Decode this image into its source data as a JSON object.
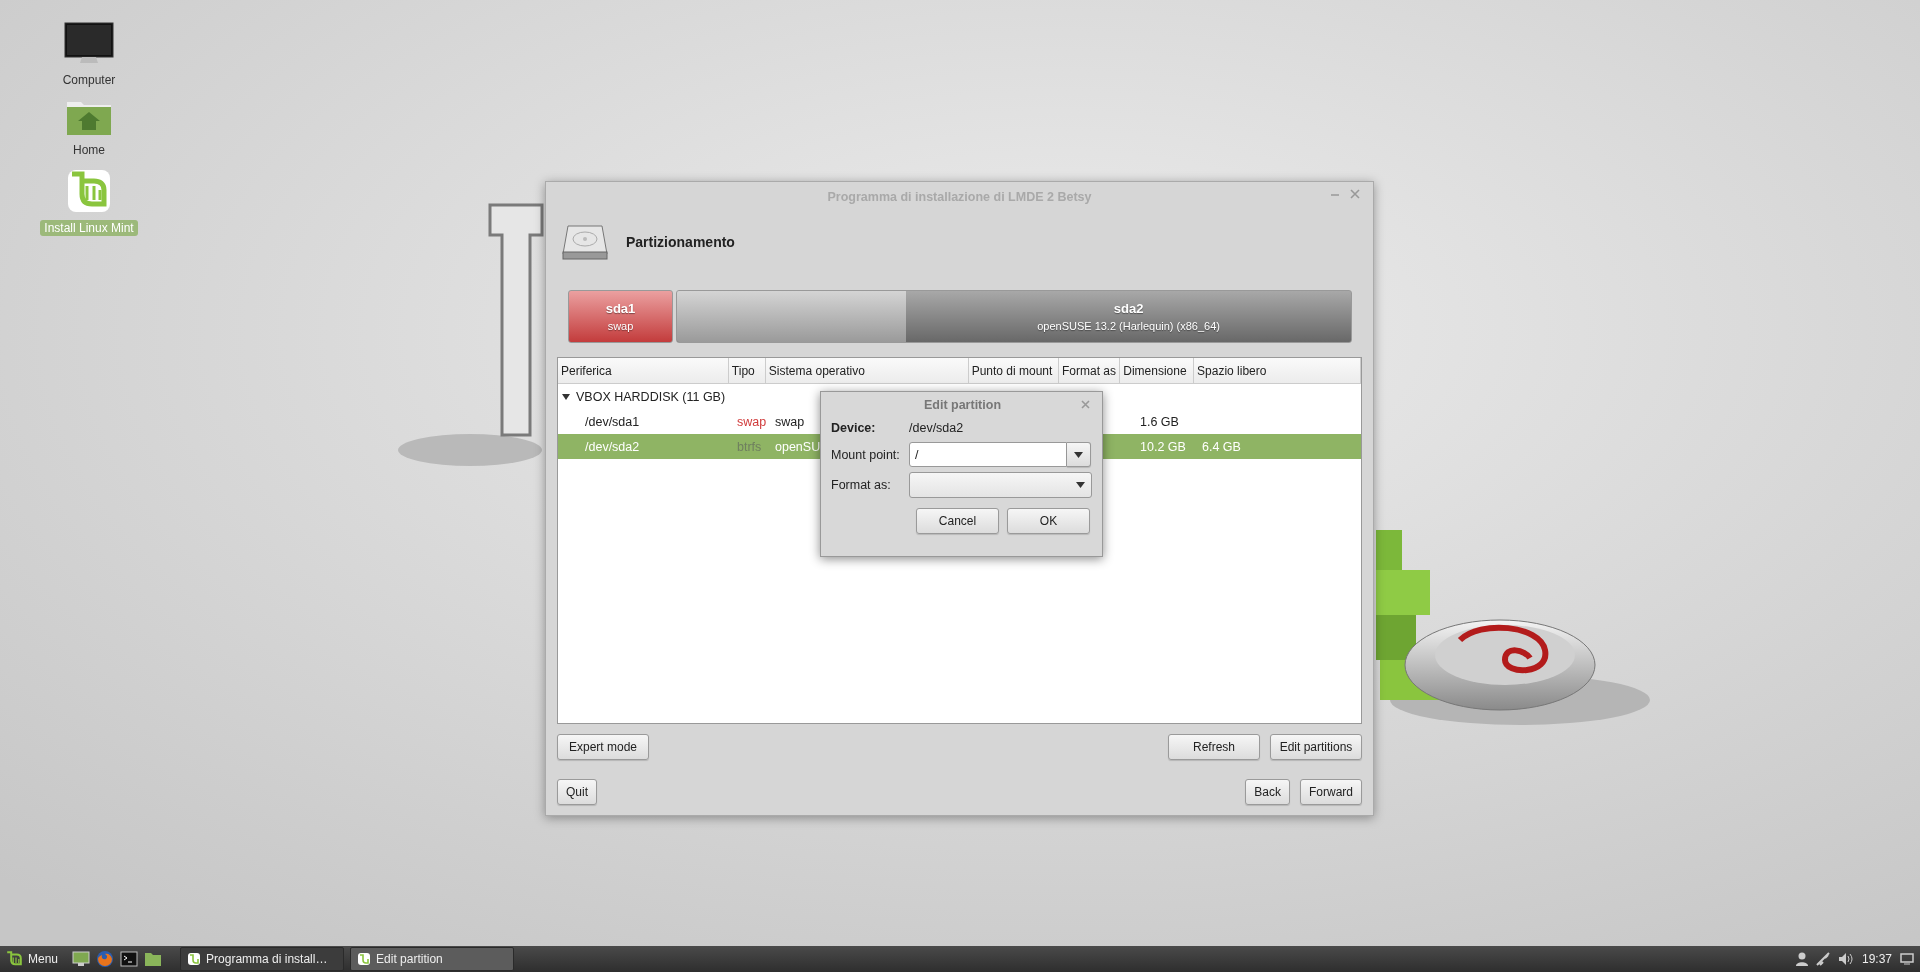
{
  "desktop": {
    "icons": [
      {
        "kind": "computer",
        "label": "Computer",
        "selected": false
      },
      {
        "kind": "home",
        "label": "Home",
        "selected": false
      },
      {
        "kind": "mint",
        "label": "Install Linux Mint",
        "selected": true
      }
    ]
  },
  "window": {
    "title": "Programma di installazione di LMDE 2 Betsy",
    "heading": "Partizionamento",
    "partitions": [
      {
        "kind": "swap",
        "name": "sda1",
        "detail": "swap"
      },
      {
        "kind": "system",
        "name": "sda2",
        "detail": "openSUSE 13.2 (Harlequin) (x86_64)",
        "level": 0.34
      }
    ],
    "columns": [
      "Periferica",
      "Tipo",
      "Sistema operativo",
      "Punto di mount",
      "Format as",
      "Dimensione",
      "Spazio libero"
    ],
    "disks": [
      {
        "device": "VBOX HARDDISK (11 GB)",
        "expanded": true,
        "children": [
          {
            "device": "/dev/sda1",
            "type": "swap",
            "color": "#d03a3a",
            "os": "swap",
            "size": "1.6 GB",
            "selected": false
          },
          {
            "device": "/dev/sda2",
            "type": "btrfs",
            "color": "#6f7f5f",
            "os": "openSU",
            "size": "10.2 GB",
            "free": "6.4 GB",
            "selected": true
          }
        ]
      }
    ],
    "left_buttons": [
      "Expert mode"
    ],
    "right_buttons": [
      "Refresh",
      "Edit partitions"
    ],
    "quit": "Quit",
    "nav_buttons": [
      "Back",
      "Forward"
    ]
  },
  "dialog": {
    "title": "Edit partition",
    "device_label": "Device:",
    "device": "/dev/sda2",
    "mount_label": "Mount point:",
    "mount_value": "/",
    "format_label": "Format as:",
    "buttons": [
      "Cancel",
      "OK"
    ]
  },
  "taskbar": {
    "menu": "Menu",
    "windows": [
      {
        "title": "Programma di install…",
        "selected": false
      },
      {
        "title": "Edit partition",
        "selected": true
      }
    ],
    "clock": "19:37"
  }
}
